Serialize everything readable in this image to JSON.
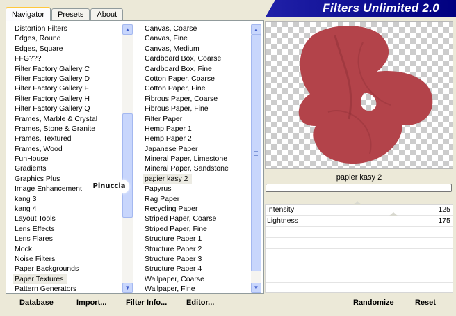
{
  "tabs": [
    {
      "label": "Navigator",
      "active": true
    },
    {
      "label": "Presets",
      "active": false
    },
    {
      "label": "About",
      "active": false
    }
  ],
  "banner": {
    "title": "Filters Unlimited 2.0"
  },
  "categories": {
    "items": [
      "Distortion Filters",
      "Edges, Round",
      "Edges, Square",
      "FFG???",
      "Filter Factory Gallery C",
      "Filter Factory Gallery D",
      "Filter Factory Gallery F",
      "Filter Factory Gallery H",
      "Filter Factory Gallery Q",
      "Frames, Marble & Crystal",
      "Frames, Stone & Granite",
      "Frames, Textured",
      "Frames, Wood",
      "FunHouse",
      "Gradients",
      "Graphics Plus",
      "Image Enhancement",
      "kang 3",
      "kang 4",
      "Layout Tools",
      "Lens Effects",
      "Lens Flares",
      "Mock",
      "Noise Filters",
      "Paper Backgrounds",
      "Paper Textures",
      "Pattern Generators"
    ],
    "selected": "Paper Textures",
    "scroll_fraction": 0.55
  },
  "filters": {
    "items": [
      "Canvas, Coarse",
      "Canvas, Fine",
      "Canvas, Medium",
      "Cardboard Box, Coarse",
      "Cardboard Box, Fine",
      "Cotton Paper, Coarse",
      "Cotton Paper, Fine",
      "Fibrous Paper, Coarse",
      "Fibrous Paper, Fine",
      "Filter Paper",
      "Hemp Paper 1",
      "Hemp Paper 2",
      "Japanese Paper",
      "Mineral Paper, Limestone",
      "Mineral Paper, Sandstone",
      "papier kasy 2",
      "Papyrus",
      "Rag Paper",
      "Recycling Paper",
      "Striped Paper, Coarse",
      "Striped Paper, Fine",
      "Structure Paper 1",
      "Structure Paper 2",
      "Structure Paper 3",
      "Structure Paper 4",
      "Wallpaper, Coarse",
      "Wallpaper, Fine"
    ],
    "selected": "papier kasy 2",
    "scroll_fraction": 0.0
  },
  "watermark": "Pinuccia",
  "buttons": {
    "database": {
      "u": "D",
      "rest": "atabase"
    },
    "import": {
      "pre": "Imp",
      "u": "o",
      "rest": "rt..."
    },
    "filter_info": {
      "pre": "Filter ",
      "u": "I",
      "rest": "nfo..."
    },
    "editor": {
      "u": "E",
      "rest": "ditor..."
    },
    "randomize": "Randomize",
    "reset": "Reset"
  },
  "preview": {
    "filter_name": "papier kasy 2",
    "shape_color": "#b3434a"
  },
  "progress": {
    "value": 0
  },
  "params": [
    {
      "label": "Intensity",
      "value": "125",
      "level": 125
    },
    {
      "label": "Lightness",
      "value": "175",
      "level": 175
    }
  ],
  "param_max": 255
}
